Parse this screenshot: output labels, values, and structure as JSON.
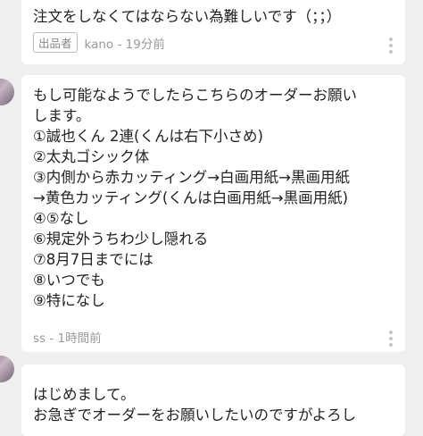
{
  "comments": [
    {
      "lines": [
        "注文をしなくてはならない為難しいです（；；）"
      ],
      "badge": "出品者",
      "author": "kano",
      "time": "19分前"
    },
    {
      "lines": [
        "もし可能なようでしたらこちらのオーダーお願い",
        "します。",
        "①誠也くん 2連(くんは右下小さめ)",
        "②太丸ゴシック体",
        "③内側から赤カッティング→白画用紙→黒画用紙",
        "→黄色カッティング(くんは白画用紙→黒画用紙)",
        "④⑤なし",
        "⑥規定外うちわ少し隠れる",
        "⑦8月7日までには",
        "⑧いつでも",
        "⑨特になし"
      ],
      "author": "ss",
      "time": "1時間前"
    },
    {
      "lines": [
        "はじめまして。",
        "お急ぎでオーダーをお願いしたいのですがよろし"
      ]
    }
  ],
  "meta_separator": "-",
  "icons": {
    "more": "more-vertical-icon",
    "avatar": "avatar"
  }
}
